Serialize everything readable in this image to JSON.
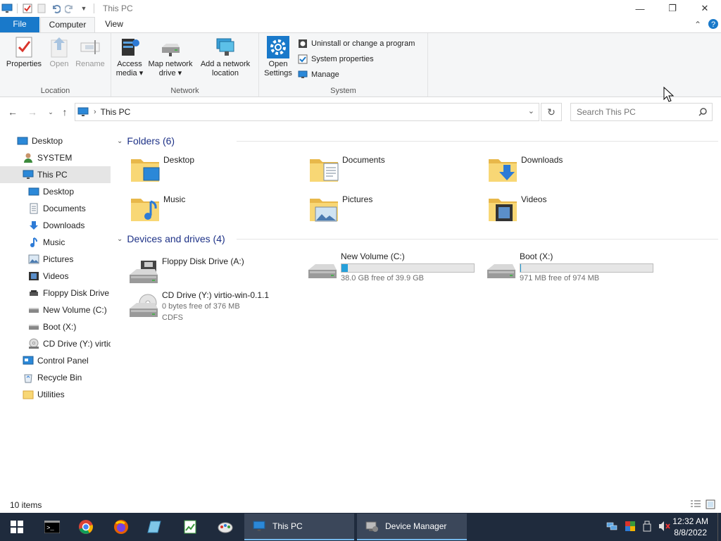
{
  "window": {
    "title": "This PC",
    "minimize_glyph": "—",
    "restore_glyph": "❐",
    "close_glyph": "✕"
  },
  "ribbon_tabs": {
    "file": "File",
    "computer": "Computer",
    "view": "View"
  },
  "ribbon": {
    "location_group": "Location",
    "network_group": "Network",
    "system_group": "System",
    "properties": "Properties",
    "open": "Open",
    "rename": "Rename",
    "access_media_1": "Access",
    "access_media_2": "media ▾",
    "map_drive_1": "Map network",
    "map_drive_2": "drive ▾",
    "add_location_1": "Add a network",
    "add_location_2": "location",
    "open_settings_1": "Open",
    "open_settings_2": "Settings",
    "uninstall": "Uninstall or change a program",
    "system_properties": "System properties",
    "manage": "Manage"
  },
  "address": {
    "crumb": "This PC",
    "search_placeholder": "Search This PC"
  },
  "nav_pane": {
    "items": [
      {
        "label": "Desktop"
      },
      {
        "label": "SYSTEM"
      },
      {
        "label": "This PC"
      },
      {
        "label": "Desktop"
      },
      {
        "label": "Documents"
      },
      {
        "label": "Downloads"
      },
      {
        "label": "Music"
      },
      {
        "label": "Pictures"
      },
      {
        "label": "Videos"
      },
      {
        "label": "Floppy Disk Drive"
      },
      {
        "label": "New Volume (C:)"
      },
      {
        "label": "Boot (X:)"
      },
      {
        "label": "CD Drive (Y:) virtio"
      },
      {
        "label": "Control Panel"
      },
      {
        "label": "Recycle Bin"
      },
      {
        "label": "Utilities"
      }
    ]
  },
  "folders_section": {
    "heading": "Folders (6)",
    "items": [
      {
        "name": "Desktop"
      },
      {
        "name": "Documents"
      },
      {
        "name": "Downloads"
      },
      {
        "name": "Music"
      },
      {
        "name": "Pictures"
      },
      {
        "name": "Videos"
      }
    ]
  },
  "drives_section": {
    "heading": "Devices and drives (4)",
    "floppy": {
      "name": "Floppy Disk Drive (A:)"
    },
    "c_drive": {
      "name": "New Volume (C:)",
      "free": "38.0 GB free of 39.9 GB",
      "used_fraction": 0.05
    },
    "x_drive": {
      "name": "Boot (X:)",
      "free": "971 MB free of 974 MB",
      "used_fraction": 0.003
    },
    "cd_drive": {
      "name": "CD Drive (Y:) virtio-win-0.1.1",
      "free": "0 bytes free of 376 MB",
      "fs": "CDFS"
    }
  },
  "status": {
    "count": "10 items"
  },
  "taskbar": {
    "app_this_pc": "This PC",
    "app_device_manager": "Device Manager",
    "time": "12:32 AM",
    "date": "8/8/2022"
  },
  "colors": {
    "accent": "#1979ca",
    "selection": "#e5e5e5",
    "section_heading": "#1e3287",
    "taskbar": "#1f2b3d",
    "drive_bar_fill": "#26a0da"
  }
}
